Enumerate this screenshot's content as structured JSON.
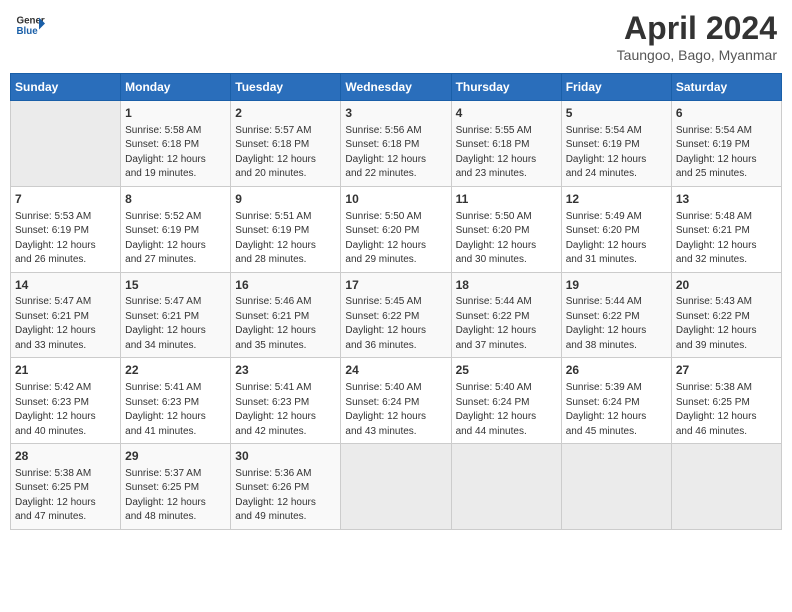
{
  "header": {
    "logo_line1": "General",
    "logo_line2": "Blue",
    "main_title": "April 2024",
    "subtitle": "Taungoo, Bago, Myanmar"
  },
  "columns": [
    "Sunday",
    "Monday",
    "Tuesday",
    "Wednesday",
    "Thursday",
    "Friday",
    "Saturday"
  ],
  "weeks": [
    [
      {
        "day": "",
        "empty": true
      },
      {
        "day": "1",
        "sunrise": "5:58 AM",
        "sunset": "6:18 PM",
        "daylight": "12 hours and 19 minutes."
      },
      {
        "day": "2",
        "sunrise": "5:57 AM",
        "sunset": "6:18 PM",
        "daylight": "12 hours and 20 minutes."
      },
      {
        "day": "3",
        "sunrise": "5:56 AM",
        "sunset": "6:18 PM",
        "daylight": "12 hours and 22 minutes."
      },
      {
        "day": "4",
        "sunrise": "5:55 AM",
        "sunset": "6:18 PM",
        "daylight": "12 hours and 23 minutes."
      },
      {
        "day": "5",
        "sunrise": "5:54 AM",
        "sunset": "6:19 PM",
        "daylight": "12 hours and 24 minutes."
      },
      {
        "day": "6",
        "sunrise": "5:54 AM",
        "sunset": "6:19 PM",
        "daylight": "12 hours and 25 minutes."
      }
    ],
    [
      {
        "day": "7",
        "sunrise": "5:53 AM",
        "sunset": "6:19 PM",
        "daylight": "12 hours and 26 minutes."
      },
      {
        "day": "8",
        "sunrise": "5:52 AM",
        "sunset": "6:19 PM",
        "daylight": "12 hours and 27 minutes."
      },
      {
        "day": "9",
        "sunrise": "5:51 AM",
        "sunset": "6:19 PM",
        "daylight": "12 hours and 28 minutes."
      },
      {
        "day": "10",
        "sunrise": "5:50 AM",
        "sunset": "6:20 PM",
        "daylight": "12 hours and 29 minutes."
      },
      {
        "day": "11",
        "sunrise": "5:50 AM",
        "sunset": "6:20 PM",
        "daylight": "12 hours and 30 minutes."
      },
      {
        "day": "12",
        "sunrise": "5:49 AM",
        "sunset": "6:20 PM",
        "daylight": "12 hours and 31 minutes."
      },
      {
        "day": "13",
        "sunrise": "5:48 AM",
        "sunset": "6:21 PM",
        "daylight": "12 hours and 32 minutes."
      }
    ],
    [
      {
        "day": "14",
        "sunrise": "5:47 AM",
        "sunset": "6:21 PM",
        "daylight": "12 hours and 33 minutes."
      },
      {
        "day": "15",
        "sunrise": "5:47 AM",
        "sunset": "6:21 PM",
        "daylight": "12 hours and 34 minutes."
      },
      {
        "day": "16",
        "sunrise": "5:46 AM",
        "sunset": "6:21 PM",
        "daylight": "12 hours and 35 minutes."
      },
      {
        "day": "17",
        "sunrise": "5:45 AM",
        "sunset": "6:22 PM",
        "daylight": "12 hours and 36 minutes."
      },
      {
        "day": "18",
        "sunrise": "5:44 AM",
        "sunset": "6:22 PM",
        "daylight": "12 hours and 37 minutes."
      },
      {
        "day": "19",
        "sunrise": "5:44 AM",
        "sunset": "6:22 PM",
        "daylight": "12 hours and 38 minutes."
      },
      {
        "day": "20",
        "sunrise": "5:43 AM",
        "sunset": "6:22 PM",
        "daylight": "12 hours and 39 minutes."
      }
    ],
    [
      {
        "day": "21",
        "sunrise": "5:42 AM",
        "sunset": "6:23 PM",
        "daylight": "12 hours and 40 minutes."
      },
      {
        "day": "22",
        "sunrise": "5:41 AM",
        "sunset": "6:23 PM",
        "daylight": "12 hours and 41 minutes."
      },
      {
        "day": "23",
        "sunrise": "5:41 AM",
        "sunset": "6:23 PM",
        "daylight": "12 hours and 42 minutes."
      },
      {
        "day": "24",
        "sunrise": "5:40 AM",
        "sunset": "6:24 PM",
        "daylight": "12 hours and 43 minutes."
      },
      {
        "day": "25",
        "sunrise": "5:40 AM",
        "sunset": "6:24 PM",
        "daylight": "12 hours and 44 minutes."
      },
      {
        "day": "26",
        "sunrise": "5:39 AM",
        "sunset": "6:24 PM",
        "daylight": "12 hours and 45 minutes."
      },
      {
        "day": "27",
        "sunrise": "5:38 AM",
        "sunset": "6:25 PM",
        "daylight": "12 hours and 46 minutes."
      }
    ],
    [
      {
        "day": "28",
        "sunrise": "5:38 AM",
        "sunset": "6:25 PM",
        "daylight": "12 hours and 47 minutes."
      },
      {
        "day": "29",
        "sunrise": "5:37 AM",
        "sunset": "6:25 PM",
        "daylight": "12 hours and 48 minutes."
      },
      {
        "day": "30",
        "sunrise": "5:36 AM",
        "sunset": "6:26 PM",
        "daylight": "12 hours and 49 minutes."
      },
      {
        "day": "",
        "empty": true
      },
      {
        "day": "",
        "empty": true
      },
      {
        "day": "",
        "empty": true
      },
      {
        "day": "",
        "empty": true
      }
    ]
  ],
  "labels": {
    "sunrise": "Sunrise:",
    "sunset": "Sunset:",
    "daylight": "Daylight:"
  }
}
